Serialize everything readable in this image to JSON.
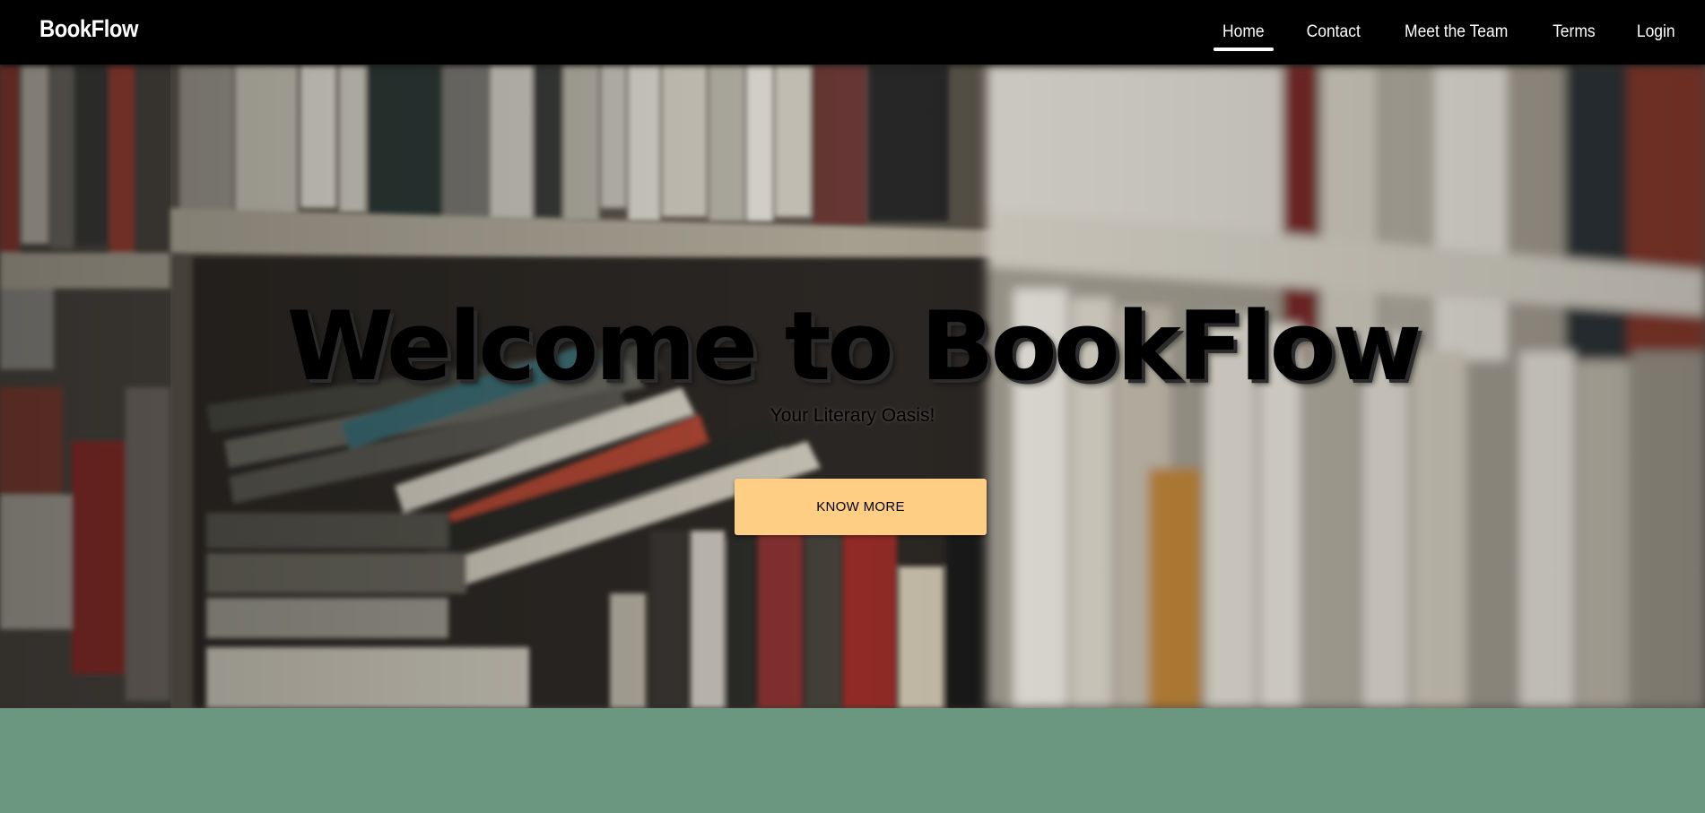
{
  "navbar": {
    "brand": "BookFlow",
    "links": [
      {
        "label": "Home",
        "active": true
      },
      {
        "label": "Contact",
        "active": false
      },
      {
        "label": "Meet the Team",
        "active": false
      },
      {
        "label": "Terms",
        "active": false
      },
      {
        "label": "Login",
        "active": false
      }
    ]
  },
  "hero": {
    "title": "Welcome to BookFlow",
    "subtitle": "Your Literary Oasis!",
    "cta_label": "KNOW MORE"
  },
  "colors": {
    "navbar_bg": "#000000",
    "cta_bg": "#ffce85",
    "footer_band": "#6b967f"
  }
}
